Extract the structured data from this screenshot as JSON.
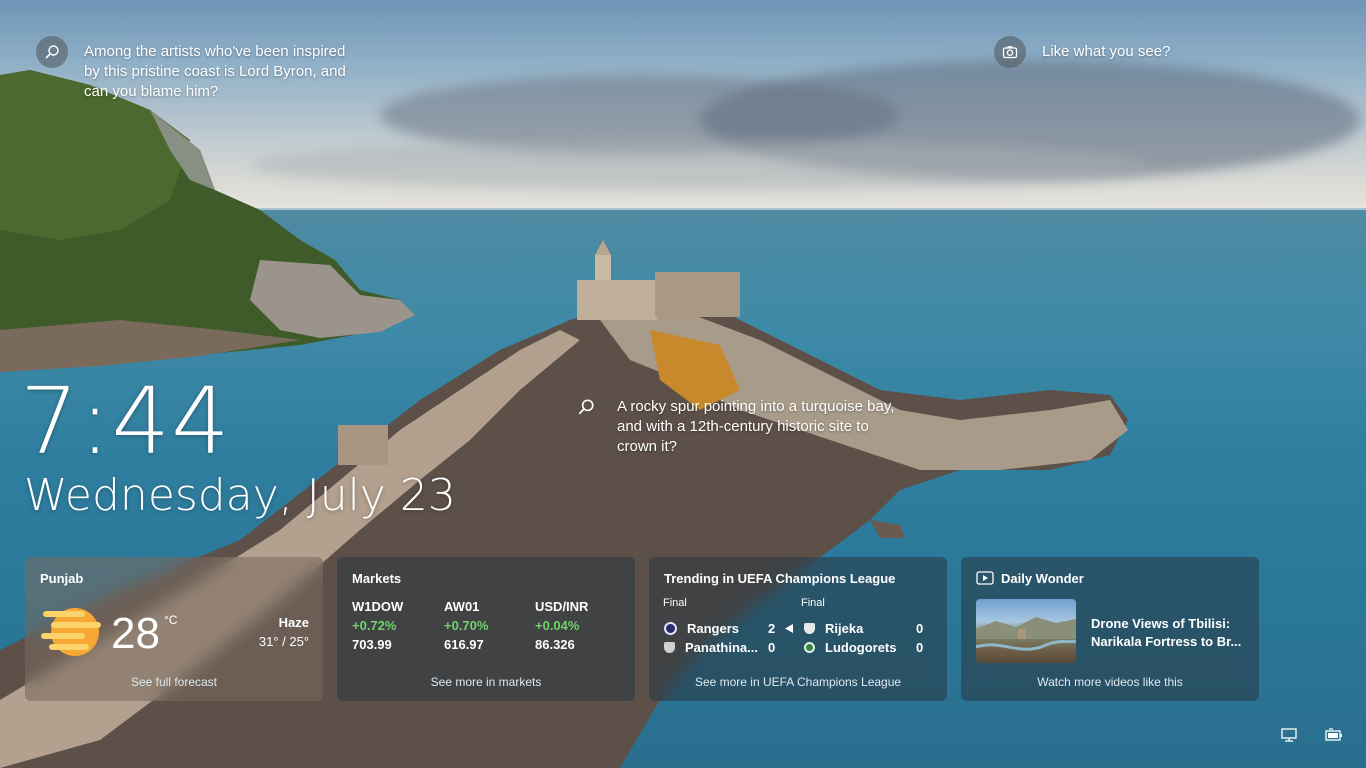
{
  "hints": {
    "top_left": "Among the artists who've been inspired by this pristine coast is Lord Byron, and can you blame him?",
    "top_right": "Like what you see?",
    "middle": "A rocky spur pointing into a turquoise bay, and with a 12th-century historic site to crown it?"
  },
  "clock": {
    "time": "7:44",
    "date": "Wednesday, July 23"
  },
  "weather": {
    "location": "Punjab",
    "temp": "28",
    "unit": "°C",
    "condition": "Haze",
    "range": "31° / 25°",
    "footer": "See full forecast",
    "icon": "haze-sun-icon"
  },
  "markets": {
    "title": "Markets",
    "items": [
      {
        "name": "W1DOW",
        "change": "+0.72%",
        "value": "703.99"
      },
      {
        "name": "AW01",
        "change": "+0.70%",
        "value": "616.97"
      },
      {
        "name": "USD/INR",
        "change": "+0.04%",
        "value": "86.326"
      }
    ],
    "footer": "See more in markets",
    "change_color": "#6fd36a"
  },
  "sports": {
    "title": "Trending in UEFA Champions League",
    "matches": [
      {
        "status": "Final",
        "home": "Rangers",
        "home_score": "2",
        "away": "Panathina...",
        "away_score": "0"
      },
      {
        "status": "Final",
        "home": "Rijeka",
        "home_score": "0",
        "away": "Ludogorets",
        "away_score": "0"
      }
    ],
    "footer": "See more in UEFA Champions League"
  },
  "wonder": {
    "title": "Daily Wonder",
    "headline_line1": "Drone Views of Tbilisi:",
    "headline_line2": "Narikala Fortress to Br...",
    "footer": "Watch more videos like this"
  }
}
